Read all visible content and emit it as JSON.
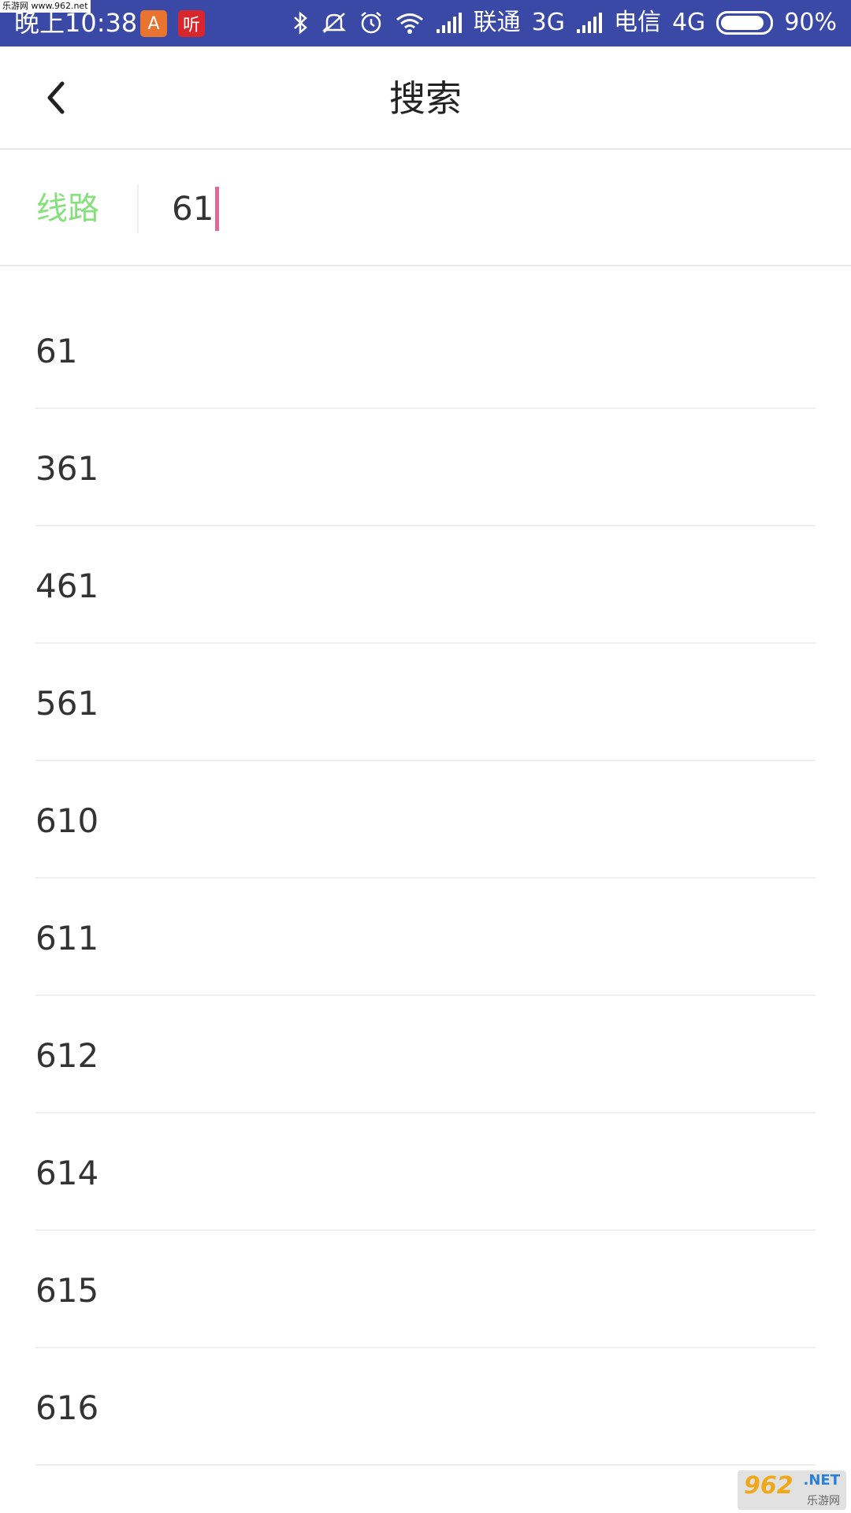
{
  "watermark_top": "乐游网 www.962.net",
  "status_bar": {
    "time": "晚上10:38",
    "app_icon_1_glyph": "A",
    "app_icon_2_glyph": "听",
    "carrier1": "联通",
    "network1": "3G",
    "carrier2": "电信",
    "network2": "4G",
    "battery_level": 0.9,
    "battery_text": "90%",
    "icons": [
      "bluetooth-icon",
      "mute-icon",
      "alarm-icon",
      "wifi-icon",
      "signal-icon"
    ]
  },
  "header": {
    "title": "搜索",
    "back_icon": "chevron-left-icon"
  },
  "search": {
    "type_label": "线路",
    "value": "61"
  },
  "results": [
    {
      "label": "61"
    },
    {
      "label": "361"
    },
    {
      "label": "461"
    },
    {
      "label": "561"
    },
    {
      "label": "610"
    },
    {
      "label": "611"
    },
    {
      "label": "612"
    },
    {
      "label": "614"
    },
    {
      "label": "615"
    },
    {
      "label": "616"
    }
  ],
  "watermark_bottom": {
    "num": "962",
    "net": ".NET",
    "sub": "乐游网"
  },
  "colors": {
    "status_bar": "#3a48a6",
    "accent_green": "#86e07c",
    "caret_pink": "#e2679a"
  }
}
